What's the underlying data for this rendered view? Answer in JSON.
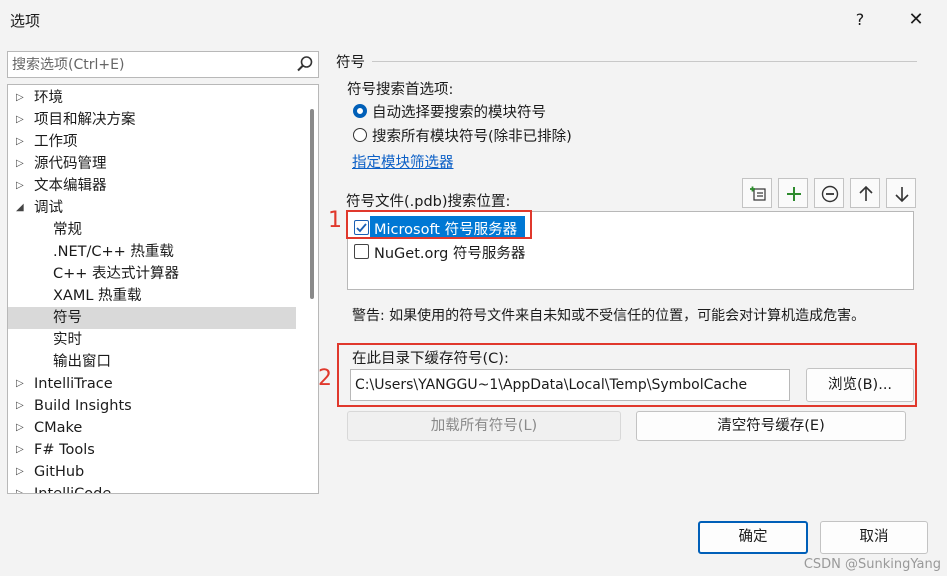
{
  "window": {
    "title": "选项",
    "help": "?",
    "close": "✕"
  },
  "search": {
    "placeholder": "搜索选项(Ctrl+E)"
  },
  "tree": {
    "items": [
      {
        "label": "环境",
        "level": 0,
        "expanded": false
      },
      {
        "label": "项目和解决方案",
        "level": 0,
        "expanded": false
      },
      {
        "label": "工作项",
        "level": 0,
        "expanded": false
      },
      {
        "label": "源代码管理",
        "level": 0,
        "expanded": false
      },
      {
        "label": "文本编辑器",
        "level": 0,
        "expanded": false
      },
      {
        "label": "调试",
        "level": 0,
        "expanded": true
      },
      {
        "label": "常规",
        "level": 1
      },
      {
        "label": ".NET/C++ 热重载",
        "level": 1
      },
      {
        "label": "C++ 表达式计算器",
        "level": 1
      },
      {
        "label": "XAML 热重载",
        "level": 1
      },
      {
        "label": "符号",
        "level": 1,
        "selected": true
      },
      {
        "label": "实时",
        "level": 1
      },
      {
        "label": "输出窗口",
        "level": 1
      },
      {
        "label": "IntelliTrace",
        "level": 0,
        "expanded": false
      },
      {
        "label": "Build Insights",
        "level": 0,
        "expanded": false
      },
      {
        "label": "CMake",
        "level": 0,
        "expanded": false
      },
      {
        "label": "F# Tools",
        "level": 0,
        "expanded": false
      },
      {
        "label": "GitHub",
        "level": 0,
        "expanded": false
      },
      {
        "label": "IntelliCode",
        "level": 0,
        "expanded": false
      }
    ]
  },
  "page": {
    "title": "符号",
    "search_pref_label": "符号搜索首选项:",
    "radio_auto": "自动选择要搜索的模块符号",
    "radio_all": "搜索所有模块符号(除非已排除)",
    "filter_link": "指定模块筛选器",
    "locations_label": "符号文件(.pdb)搜索位置:",
    "locations": [
      {
        "label": "Microsoft 符号服务器",
        "checked": true
      },
      {
        "label": "NuGet.org 符号服务器",
        "checked": false
      }
    ],
    "warning": "警告: 如果使用的符号文件来自未知或不受信任的位置，可能会对计算机造成危害。",
    "cache_label": "在此目录下缓存符号(C):",
    "cache_path": "C:\\Users\\YANGGU~1\\AppData\\Local\\Temp\\SymbolCache",
    "browse": "浏览(B)...",
    "load_all": "加载所有符号(L)",
    "clear_cache": "清空符号缓存(E)",
    "annotation_1": "1",
    "annotation_2": "2"
  },
  "footer": {
    "ok": "确定",
    "cancel": "取消",
    "watermark": "CSDN @SunkingYang"
  },
  "colors": {
    "accent": "#005fb8",
    "annotation": "#e0382c",
    "selection": "#0078d4"
  }
}
